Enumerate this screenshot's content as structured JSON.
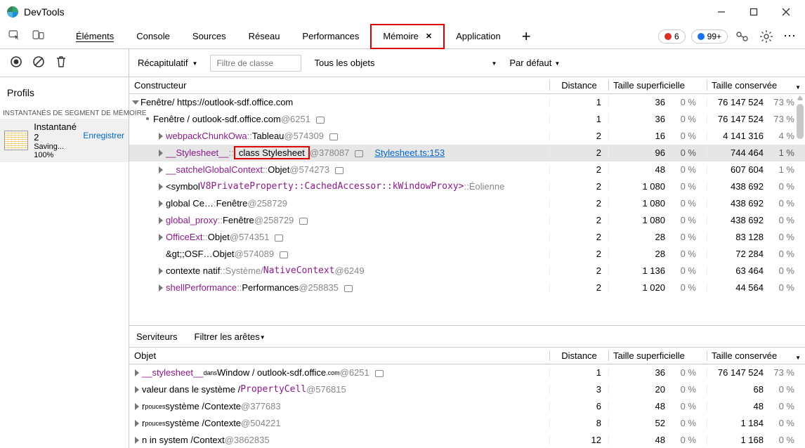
{
  "window": {
    "title": "DevTools"
  },
  "tabs": {
    "elements": "Éléments",
    "console": "Console",
    "sources": "Sources",
    "network": "Réseau",
    "perf": "Performances",
    "memory": "Mémoire",
    "application": "Application"
  },
  "badges": {
    "errors_count": "6",
    "info_count": "99+"
  },
  "filters": {
    "recap": "Récapitulatif",
    "class_filter_placeholder": "Filtre de classe",
    "all_objects": "Tous les objets",
    "default": "Par défaut"
  },
  "sidebar": {
    "profils": "Profils",
    "header": "INSTANTANÉS DE SEGMENT DE MÉMOIRE",
    "snapshot_name": "Instantané 2",
    "snapshot_status": "Saving... 100%",
    "enregistrer": "Enregistrer"
  },
  "headers": {
    "constructor": "Constructeur",
    "distance": "Distance",
    "shallow": "Taille superficielle",
    "retained": "Taille conservée",
    "object": "Objet"
  },
  "rows": [
    {
      "indent": 0,
      "tri": "open",
      "text_parts": [
        {
          "t": "Fenêtre",
          "cls": ""
        },
        {
          "t": " / https://outlook-sdf.office.com",
          "cls": ""
        }
      ],
      "d": "1",
      "sv": "36",
      "sp": "0 %",
      "rv": "76 147 524",
      "rp": "73 %"
    },
    {
      "indent": 1,
      "bullet": true,
      "text_parts": [
        {
          "t": "Fenêtre / outlook-sdf.office.com",
          "cls": ""
        },
        {
          "t": " @6251",
          "cls": "grey"
        }
      ],
      "sq_after": true,
      "d": "1",
      "sv": "36",
      "sp": "0 %",
      "rv": "76 147 524",
      "rp": "73 %"
    },
    {
      "indent": 2,
      "tri": "closed",
      "text_parts": [
        {
          "t": "webpackChunkOwa",
          "cls": "purple"
        },
        {
          "t": " ::",
          "cls": "grey"
        },
        {
          "t": " Tableau",
          "cls": ""
        },
        {
          "t": " @574309",
          "cls": "grey"
        }
      ],
      "sq_after": true,
      "d": "2",
      "sv": "16",
      "sp": "0 %",
      "rv": "4 141 316",
      "rp": "4 %"
    },
    {
      "indent": 2,
      "tri": "closed",
      "sel": true,
      "text_parts": [
        {
          "t": "__Stylesheet__",
          "cls": "purple"
        },
        {
          "t": " ::",
          "cls": "grey"
        },
        {
          "t": "class Stylesheet",
          "cls": "redbox-inline"
        },
        {
          "t": "@378087",
          "cls": "grey"
        }
      ],
      "sq_after": true,
      "link": "Stylesheet.ts:153",
      "d": "2",
      "sv": "96",
      "sp": "0 %",
      "rv": "744 464",
      "rp": "1 %"
    },
    {
      "indent": 2,
      "tri": "closed",
      "text_parts": [
        {
          "t": "__satchelGlobalContext",
          "cls": "purple"
        },
        {
          "t": " ::",
          "cls": "grey"
        },
        {
          "t": " Objet",
          "cls": ""
        },
        {
          "t": " @574273",
          "cls": "grey"
        }
      ],
      "sq_after": true,
      "d": "2",
      "sv": "48",
      "sp": "0 %",
      "rv": "607 604",
      "rp": "1 %"
    },
    {
      "indent": 2,
      "tri": "closed",
      "text_parts": [
        {
          "t": "<symbol ",
          "cls": ""
        },
        {
          "t": "V8PrivateProperty::CachedAccessor::kWindowProxy>",
          "cls": "purple mono"
        },
        {
          "t": " ::",
          "cls": "grey"
        },
        {
          "t": " Éolienne",
          "cls": "grey"
        }
      ],
      "d": "2",
      "sv": "1 080",
      "sp": "0 %",
      "rv": "438 692",
      "rp": "0 %"
    },
    {
      "indent": 2,
      "tri": "closed",
      "text_parts": [
        {
          "t": "global Ce… ",
          "cls": ""
        },
        {
          "t": ":",
          "cls": "grey"
        },
        {
          "t": " Fenêtre",
          "cls": ""
        },
        {
          "t": " @258729",
          "cls": "grey"
        }
      ],
      "d": "2",
      "sv": "1 080",
      "sp": "0 %",
      "rv": "438 692",
      "rp": "0 %"
    },
    {
      "indent": 2,
      "tri": "closed",
      "text_parts": [
        {
          "t": "global_proxy",
          "cls": "purple"
        },
        {
          "t": " ::",
          "cls": "grey"
        },
        {
          "t": " Fenêtre",
          "cls": ""
        },
        {
          "t": " @258729",
          "cls": "grey"
        }
      ],
      "sq_after": true,
      "d": "2",
      "sv": "1 080",
      "sp": "0 %",
      "rv": "438 692",
      "rp": "0 %"
    },
    {
      "indent": 2,
      "tri": "closed",
      "text_parts": [
        {
          "t": "OfficeExt",
          "cls": "purple"
        },
        {
          "t": " ::",
          "cls": "grey"
        },
        {
          "t": " Objet",
          "cls": ""
        },
        {
          "t": " @574351",
          "cls": "grey"
        }
      ],
      "sq_after": true,
      "d": "2",
      "sv": "28",
      "sp": "0 %",
      "rv": "83 128",
      "rp": "0 %"
    },
    {
      "indent": 2,
      "text_parts": [
        {
          "t": "&gt;;OSF…",
          "cls": ""
        },
        {
          "t": " Objet",
          "cls": ""
        },
        {
          "t": " @574089",
          "cls": "grey"
        }
      ],
      "sq_after": true,
      "d": "2",
      "sv": "28",
      "sp": "0 %",
      "rv": "72 284",
      "rp": "0 %"
    },
    {
      "indent": 2,
      "tri": "closed",
      "text_parts": [
        {
          "t": "contexte natif     ",
          "cls": ""
        },
        {
          "t": "::",
          "cls": "grey"
        },
        {
          "t": " Système/",
          "cls": "grey"
        },
        {
          "t": "  NativeContext",
          "cls": "purple mono"
        },
        {
          "t": " @6249",
          "cls": "grey"
        }
      ],
      "d": "2",
      "sv": "1 136",
      "sp": "0 %",
      "rv": "63 464",
      "rp": "0 %"
    },
    {
      "indent": 2,
      "tri": "closed",
      "text_parts": [
        {
          "t": "shellPerformance",
          "cls": "purple"
        },
        {
          "t": " ::",
          "cls": "grey"
        },
        {
          "t": " Performances",
          "cls": ""
        },
        {
          "t": " @258835",
          "cls": "grey"
        }
      ],
      "sq_after": true,
      "d": "2",
      "sv": "1 020",
      "sp": "0 %",
      "rv": "44 564",
      "rp": "0 %"
    }
  ],
  "bottom_bar": {
    "servers": "Serviteurs",
    "filter_edges": "Filtrer les arêtes"
  },
  "rowsB": [
    {
      "tri": "closed",
      "text_parts": [
        {
          "t": "__stylesheet__",
          "cls": "purple"
        },
        {
          "t": " dans",
          "cls": "tiny"
        },
        {
          "t": " Window / outlook-sdf.office",
          "cls": ""
        },
        {
          "t": "           .com  ",
          "cls": "tiny"
        },
        {
          "t": " @6251",
          "cls": "grey"
        }
      ],
      "sq_after": true,
      "d": "1",
      "sv": "36",
      "sp": "0 %",
      "rv": "76 147 524",
      "rp": "73 %"
    },
    {
      "tri": "closed",
      "text_parts": [
        {
          "t": "valeur dans le système / ",
          "cls": ""
        },
        {
          "t": "  PropertyCell",
          "cls": "purple mono"
        },
        {
          "t": " @576815",
          "cls": "grey"
        }
      ],
      "d": "3",
      "sv": "20",
      "sp": "0 %",
      "rv": "68",
      "rp": "0 %"
    },
    {
      "tri": "closed",
      "text_parts": [
        {
          "t": "r ",
          "cls": ""
        },
        {
          "t": "pouces",
          "cls": "tiny"
        },
        {
          "t": " système  /",
          "cls": ""
        },
        {
          "t": " Contexte",
          "cls": ""
        },
        {
          "t": " @377683",
          "cls": "grey"
        }
      ],
      "d": "6",
      "sv": "48",
      "sp": "0 %",
      "rv": "48",
      "rp": "0 %"
    },
    {
      "tri": "closed",
      "text_parts": [
        {
          "t": "r ",
          "cls": ""
        },
        {
          "t": "pouces",
          "cls": "tiny"
        },
        {
          "t": " système  /",
          "cls": ""
        },
        {
          "t": " Contexte",
          "cls": ""
        },
        {
          "t": " @504221",
          "cls": "grey"
        }
      ],
      "d": "8",
      "sv": "52",
      "sp": "0 %",
      "rv": "1 184",
      "rp": "0 %"
    },
    {
      "tri": "closed",
      "text_parts": [
        {
          "t": "n in system / ",
          "cls": ""
        },
        {
          "t": "Context",
          "cls": ""
        },
        {
          "t": " @3862835",
          "cls": "grey"
        }
      ],
      "d": "12",
      "sv": "48",
      "sp": "0 %",
      "rv": "1 168",
      "rp": "0 %"
    }
  ]
}
